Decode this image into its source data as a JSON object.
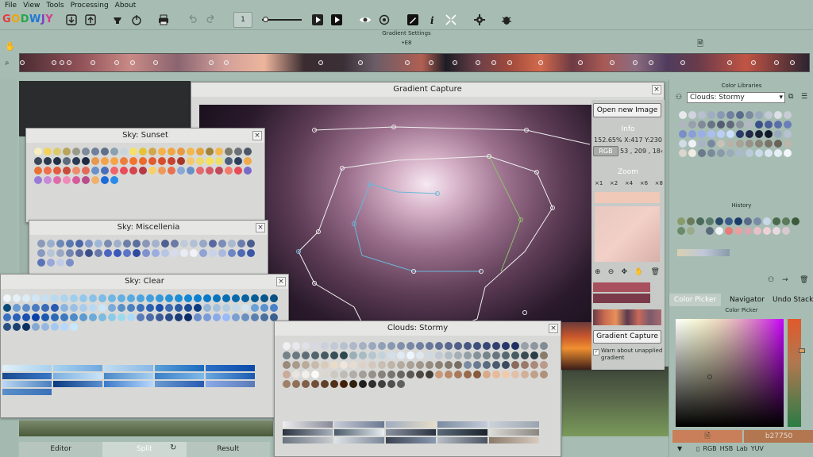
{
  "menu": [
    "File",
    "View",
    "Tools",
    "Processing",
    "About"
  ],
  "logo": {
    "text": "GODWJY",
    "colors": [
      "#e23c3c",
      "#f0a500",
      "#2aa54a",
      "#1e78d8",
      "#7a3ec8",
      "#d83a8c"
    ]
  },
  "toolbar": {
    "page_number": "1"
  },
  "gradient_settings": {
    "title": "Gradient Settings",
    "stops_count": "•E8"
  },
  "capture": {
    "title": "Gradient Capture",
    "open_btn": "Open new Image",
    "info_label": "Info",
    "info_coords": "152.65% X:417 Y:230",
    "color_mode": "RGB",
    "rgb_value": "53 , 209 , 18‹",
    "zoom_label": "Zoom",
    "zoom_levels": [
      "×1",
      "×2",
      "×4",
      "×6",
      "×8"
    ],
    "capture_btn": "Gradient Capture",
    "warn_text": "Warn about unapplied gradient"
  },
  "windows": {
    "sunset": "Sky: Sunset",
    "misc": "Sky: Miscellenia",
    "clear": "Sky: Clear",
    "stormy": "Clouds: Stormy"
  },
  "right": {
    "libraries_title": "Color Libraries",
    "library_selected": "Clouds: Stormy",
    "history_title": "History",
    "tabs": [
      "Color Picker",
      "Navigator",
      "Undo Stack"
    ],
    "picker_title": "Color Picker",
    "hex_value": "b27750",
    "mode_buttons": [
      "RGB",
      "HSB",
      "Lab",
      "YUV"
    ]
  },
  "bottom_tabs": [
    "Editor",
    "Split",
    "Result"
  ],
  "palettes": {
    "sunset": [
      "#f7eec0",
      "#f4d25a",
      "#dccb6a",
      "#b9a45a",
      "#9a9a8a",
      "#7d8a9a",
      "#6d7f9a",
      "#5d6f8a",
      "#8aa0b0",
      "#c8d6dc",
      "#f5e06a",
      "#e6c23a",
      "#d2a64a",
      "#f5b24a",
      "#f0a63e",
      "#e89a40",
      "#f2b84a",
      "#e6a43c",
      "#a0843a",
      "#f5b84e",
      "#7c7a6a",
      "#6b6f76",
      "#4d5768",
      "#3c4556",
      "#2c3a4c",
      "#233046",
      "#5c6a7a",
      "#2a3a52",
      "#1c2a44",
      "#e8984a",
      "#f3a24c",
      "#f6a448",
      "#e8803c",
      "#f3742c",
      "#ec6a2a",
      "#e25a2e",
      "#d84c2c",
      "#c8402e",
      "#a43628",
      "#f4c86a",
      "#f0d86a",
      "#f5e25a",
      "#ece06a",
      "#4a5e7a",
      "#2e3e5a",
      "#f0a84c",
      "#ea7036",
      "#f26d4a",
      "#e45c3c",
      "#c84a3a",
      "#ed8c6a",
      "#e46a5a",
      "#6a90c8",
      "#4a6fb8",
      "#f2646a",
      "#ea4c5a",
      "#d8444c",
      "#b63a46",
      "#f8d06a",
      "#f09a5a",
      "#e8704e",
      "#8aa8d8",
      "#6a90c8",
      "#e56a70",
      "#d65a66",
      "#c04a5a",
      "#f47a6a",
      "#e84a56",
      "#7a6ac8",
      "#9a7ad8",
      "#c88ad8",
      "#e06aa8",
      "#f08ab8",
      "#d85a9a",
      "#ba4a8a",
      "#f0b06a",
      "#1c6ad8",
      "#2a8ae8"
    ],
    "misc": [
      "#8a9ab8",
      "#9aaed0",
      "#6d87b6",
      "#5a78b0",
      "#4a66a6",
      "#7d94c4",
      "#9fb6d8",
      "#7a8ab0",
      "#a0b0c8",
      "#6b7ea8",
      "#5c6f9c",
      "#8a96b8",
      "#a4b2cc",
      "#4e6090",
      "#6a7aa4",
      "#c0cad8",
      "#b2c0d6",
      "#96a8c8",
      "#5868a0",
      "#7c8cb6",
      "#aab8d0",
      "#6c7cac",
      "#4a5c90",
      "#8898c0",
      "#b8c4d8",
      "#9aa8c4",
      "#7484b0",
      "#5a6a9c",
      "#3a4e8c",
      "#6878aa",
      "#4a64c0",
      "#3a58b8",
      "#5a74c8",
      "#2e4aa0",
      "#7e92d0",
      "#9aace0",
      "#b6c4e6",
      "#d6dcee",
      "#e8ecf4",
      "#f0f2f8",
      "#8ea2d4",
      "#c8d2ea",
      "#aabade",
      "#6e86c4",
      "#4e6ab6",
      "#3a56a6",
      "#5a72b6",
      "#98a8d8",
      "#c0cce8",
      "#7a8ec8"
    ],
    "clear": [
      "#eef6fa",
      "#e4f0f8",
      "#dcecf6",
      "#d0e6f4",
      "#c4e0f2",
      "#b8daf0",
      "#acd4ee",
      "#a0ceec",
      "#94c8ea",
      "#88c2e8",
      "#7cbce6",
      "#70b6e4",
      "#64b0e2",
      "#58aae0",
      "#4ca4de",
      "#409edc",
      "#3498da",
      "#2892d8",
      "#1c8cd6",
      "#1086d4",
      "#0a80d2",
      "#087ac8",
      "#0874be",
      "#086eb4",
      "#0868aa",
      "#0862a0",
      "#085c96",
      "#08568c",
      "#085082",
      "#084a78",
      "#6a9ad0",
      "#5a8ac8",
      "#4a7ac0",
      "#3a6ab8",
      "#2a5ab0",
      "#8ab4e0",
      "#9ac0e6",
      "#aaccec",
      "#bad8f2",
      "#cae4f8",
      "#7aa8d8",
      "#5a90c8",
      "#4a80c0",
      "#3a70b8",
      "#2a60b0",
      "#1a50a8",
      "#3a6ab0",
      "#2a5aa0",
      "#1a4a90",
      "#0a3a80",
      "#94b4d6",
      "#a4c0dc",
      "#b4cce2",
      "#c4d8e8",
      "#d4e4ee",
      "#6aa0d8",
      "#5a90d0",
      "#4a80c8",
      "#3a70c0",
      "#2a60b8",
      "#1a50b0",
      "#0a40a8",
      "#1c5ab0",
      "#2c6ab8",
      "#3c7ac0",
      "#4c8ac8",
      "#5c9ad0",
      "#6caad8",
      "#7cbae0",
      "#8ccae8",
      "#9cdaf0",
      "#acdaf8",
      "#5a7ab8",
      "#4a6aa8",
      "#3a5a98",
      "#2a4a88",
      "#1a3a78",
      "#0a2a68",
      "#6a8ac8",
      "#7a9ad8",
      "#8aaae8",
      "#9abaf8",
      "#7aa0d0",
      "#6a90c0",
      "#5a80b0",
      "#4a70a0",
      "#3a6090",
      "#2a5080",
      "#1a4070",
      "#0a3060",
      "#86a8d0",
      "#96b8e0",
      "#a6c8f0",
      "#b6d8ff",
      "#c6e8ff"
    ],
    "stormy": [
      "#f0f0f2",
      "#e8e8ee",
      "#e0e0e8",
      "#d6d8e2",
      "#ccd0dc",
      "#c2c8d6",
      "#b8c0d0",
      "#aeb8ca",
      "#a4b0c4",
      "#9aa8be",
      "#90a0b8",
      "#8898b2",
      "#8090ac",
      "#7888a6",
      "#7080a0",
      "#68789a",
      "#607094",
      "#58688e",
      "#506088",
      "#485882",
      "#40507c",
      "#384876",
      "#304070",
      "#28386a",
      "#203064",
      "#9aa0a8",
      "#8e969e",
      "#828c94",
      "#76828a",
      "#6a7880",
      "#5e6e76",
      "#52646c",
      "#465a62",
      "#3a5058",
      "#2e464e",
      "#9aaeb8",
      "#a8bac4",
      "#b6c6d0",
      "#c4d2dc",
      "#d2dee8",
      "#e0eaf4",
      "#eef6ff",
      "#dfe6ee",
      "#d0d8e0",
      "#c1cad2",
      "#b2bcc4",
      "#a3aeb6",
      "#94a0a8",
      "#85929a",
      "#76848c",
      "#67767e",
      "#586870",
      "#495a62",
      "#3a4c54",
      "#2b3e46",
      "#8a7a6a",
      "#9a8a7a",
      "#aa9a8a",
      "#baaa9a",
      "#cabaaa",
      "#dacaba",
      "#eadaca",
      "#f0e6dc",
      "#e6dcd2",
      "#dcd2c8",
      "#d2c8be",
      "#c8beb4",
      "#beb4aa",
      "#b4aaa0",
      "#aaa096",
      "#a0968c",
      "#968c82",
      "#8c8278",
      "#82786e",
      "#786e64",
      "#7a8aa0",
      "#6a7a90",
      "#5a6a80",
      "#4a5a70",
      "#3a4a60",
      "#8a6a5a",
      "#9a7a6a",
      "#aa8a7a",
      "#ba9a8a",
      "#caaa9a",
      "#e8e4de",
      "#f2f0ec",
      "#fcfaf6",
      "#dad6d0",
      "#ccc8c2",
      "#bebab4",
      "#b0aca6",
      "#a29e98",
      "#94908a",
      "#86827c",
      "#78746e",
      "#6a6660",
      "#5c5852",
      "#4e4a44",
      "#403c36",
      "#c89a7a",
      "#b88a6a",
      "#a87a5a",
      "#986a4a",
      "#885a3a",
      "#d8aa8a",
      "#e8ba9a",
      "#f0caaa",
      "#e0c0a8",
      "#d0b098",
      "#c0a088",
      "#b09078",
      "#a08068",
      "#907058",
      "#806048",
      "#705038",
      "#604028",
      "#503018",
      "#402008",
      "#302010",
      "#202020",
      "#303030",
      "#404040",
      "#505050",
      "#606060"
    ],
    "libraries": [
      "#e8e8ee",
      "#d0d4de",
      "#b8c0d0",
      "#a0acc2",
      "#8898b2",
      "#7080a0",
      "#586c8c",
      "#7a8aa0",
      "#9aa8be",
      "#c2c8d6",
      "#dcdfe6",
      "#c8ccd4",
      "#b0b6c0",
      "#98a0ac",
      "#808a98",
      "#6a7484",
      "#545e70",
      "#606a7a",
      "#8a929e",
      "#b2b8c2",
      "#3a4e8a",
      "#4a5e9a",
      "#5a6eaa",
      "#6a7eba",
      "#7a8eca",
      "#8a9eda",
      "#9aaee8",
      "#aabef0",
      "#bacef8",
      "#cadeff",
      "#2a3a6a",
      "#202a4a",
      "#182036",
      "#10182a",
      "#9aa8be",
      "#b6c2d2",
      "#d2dce6",
      "#eef2f6",
      "#a8b4c4",
      "#7888a0",
      "#c8c2b8",
      "#b8b2a8",
      "#a8a298",
      "#989288",
      "#888278",
      "#787268",
      "#686258",
      "#bcb6ac",
      "#dcd6cc",
      "#f0ece4",
      "#6a7a8a",
      "#7a8a9a",
      "#8a9aaa",
      "#9aaaba",
      "#aabaca",
      "#bacada",
      "#cadaea",
      "#dae6f2",
      "#e6eef6",
      "#f2f6fa"
    ],
    "history": [
      "#8a9a6a",
      "#6a7a5a",
      "#4a6a5a",
      "#5a7a6a",
      "#2a4a6a",
      "#3a5a8a",
      "#1a3a6a",
      "#5a6a8a",
      "#7a8aaa",
      "#c8d8e8",
      "#4a6a4a",
      "#5a7a5a",
      "#3a5a3a",
      "#6a8a6a",
      "#9aaa8a",
      "#aababa",
      "#5a6a7a",
      "#f0f4f8",
      "#e87a7a",
      "#e8a0a0",
      "#d8a8b0",
      "#e8c0c8",
      "#f0d0d8",
      "#e8d8e0",
      "#d8c8d0"
    ]
  }
}
